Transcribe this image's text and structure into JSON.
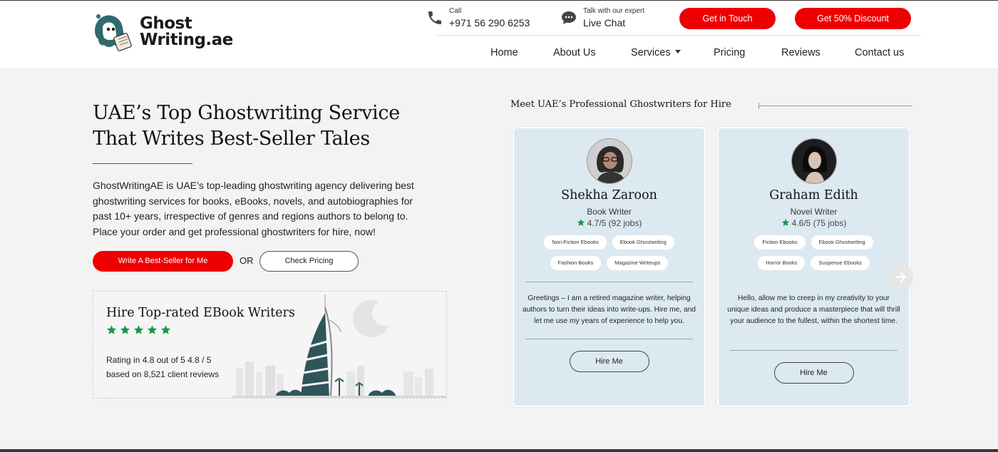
{
  "header": {
    "logo": {
      "line1": "Ghost",
      "line2": "Writing.ae"
    },
    "call": {
      "label": "Call",
      "number": "+971 56 290 6253"
    },
    "chat": {
      "label": "Talk with our expert",
      "action": "Live Chat"
    },
    "get_in_touch": "Get in Touch",
    "discount": "Get 50% Discount",
    "nav": [
      "Home",
      "About Us",
      "Services",
      "Pricing",
      "Reviews",
      "Contact us"
    ]
  },
  "hero": {
    "title_line1": "UAE’s Top Ghostwriting Service",
    "title_line2": "That Writes Best-Seller Tales",
    "description": "GhostWritingAE is UAE’s top-leading ghostwriting agency delivering best ghostwriting services for books, eBooks, novels, and autobiographies for past 10+ years, irrespective of genres and regions authors to belong to. Place your order and get professional ghostwriters for hire, now!",
    "cta_primary": "Write A Best-Seller for Me",
    "or": "OR",
    "cta_secondary": "Check Pricing"
  },
  "rating_box": {
    "title": "Hire Top-rated EBook Writers",
    "stars": 5,
    "text_line1": "Rating in 4.8 out of 5 4.8 / 5",
    "text_line2": "based on 8,521 client reviews",
    "star_color": "#119944"
  },
  "writers": {
    "heading": "Meet UAE’s Professional Ghostwriters for Hire",
    "cards": [
      {
        "name": "Shekha Zaroon",
        "role": "Book Writer",
        "score": "4.7/5 (92 jobs)",
        "tags": [
          "Non-Fiction Ebooks",
          "Ebook Ghostwriting",
          "Fashion Books",
          "Magazine Writeups"
        ],
        "bio": "Greetings – I am a retired magazine writer, helping authors to turn their ideas into write-ups. Hire me, and let me use my years of experience to help you.",
        "button": "Hire Me"
      },
      {
        "name": "Graham Edith",
        "role": "Novel Writer",
        "score": "4.6/5 (75 jobs)",
        "tags": [
          "Fiction Ebooks",
          "Ebook Ghostwriting",
          "Horror Books",
          "Suspense Ebooks"
        ],
        "bio": "Hello, allow me to creep in my creativity to your unique ideas and produce a masterpiece that will thrill your audience to the fullest, within the shortest time.",
        "button": "Hire Me"
      }
    ]
  },
  "colors": {
    "accent": "#ee0000",
    "card_bg": "#dce9f1",
    "page_bg": "#f3f3f3"
  }
}
